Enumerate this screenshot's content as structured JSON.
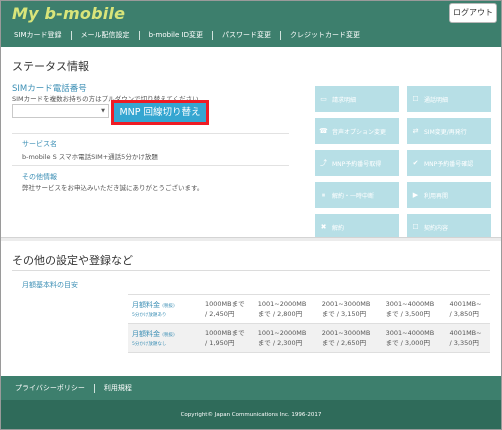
{
  "header": {
    "logo": "My b-mobile",
    "logout_label": "ログアウト",
    "nav": [
      {
        "label": "SIMカード登録"
      },
      {
        "label": "メール配信設定"
      },
      {
        "label": "b-mobile ID変更"
      },
      {
        "label": "パスワード変更"
      },
      {
        "label": "クレジットカード変更"
      }
    ]
  },
  "status": {
    "title": "ステータス情報",
    "sim_label": "SIMカード電話番号",
    "sim_help": "SIMカードを複数お持ちの方はプルダウンで切り替えてください",
    "sim_selected": "",
    "mnp_button": "MNP 回線切り替え",
    "service_label": "サービス名",
    "service_value": "b-mobile S スマホ電話SIM+通話5分かけ放題",
    "other_label": "その他情報",
    "other_value": "弊社サービスをお申込みいただき誠にありがとうございます。",
    "tiles": [
      {
        "icon": "▭",
        "label": "請求明細"
      },
      {
        "icon": "☐",
        "label": "通話明細"
      },
      {
        "icon": "☎",
        "label": "音声オプション変更"
      },
      {
        "icon": "⇄",
        "label": "SIM変更/再発行"
      },
      {
        "icon": "⤴",
        "label": "MNP予約番号取得"
      },
      {
        "icon": "✔",
        "label": "MNP予約番号確認"
      },
      {
        "icon": "⏸",
        "label": "解約・一時中断"
      },
      {
        "icon": "▶",
        "label": "利用再開"
      },
      {
        "icon": "✖",
        "label": "解約"
      },
      {
        "icon": "☐",
        "label": "契約内容"
      }
    ]
  },
  "other_settings": {
    "title": "その他の設定や登録など",
    "subtitle": "月額基本料の目安",
    "rows": [
      {
        "head": "月額料金",
        "tax": "(税抜)",
        "note": "5分かけ放題あり",
        "cells": [
          {
            "l1": "1000MBまで",
            "l2": "/ 2,450円"
          },
          {
            "l1": "1001~2000MB",
            "l2": "まで / 2,800円"
          },
          {
            "l1": "2001~3000MB",
            "l2": "まで / 3,150円"
          },
          {
            "l1": "3001~4000MB",
            "l2": "まで / 3,500円"
          },
          {
            "l1": "4001MB~",
            "l2": "/ 3,850円"
          }
        ]
      },
      {
        "head": "月額料金",
        "tax": "(税抜)",
        "note": "5分かけ放題なし",
        "cells": [
          {
            "l1": "1000MBまで",
            "l2": "/ 1,950円"
          },
          {
            "l1": "1001~2000MB",
            "l2": "まで / 2,300円"
          },
          {
            "l1": "2001~3000MB",
            "l2": "まで / 2,650円"
          },
          {
            "l1": "3001~4000MB",
            "l2": "まで / 3,000円"
          },
          {
            "l1": "4001MB~",
            "l2": "/ 3,350円"
          }
        ]
      }
    ]
  },
  "footer": {
    "links": [
      {
        "label": "プライバシーポリシー"
      },
      {
        "label": "利用規程"
      }
    ],
    "copyright": "Copyright© Japan Communications Inc. 1996-2017"
  }
}
